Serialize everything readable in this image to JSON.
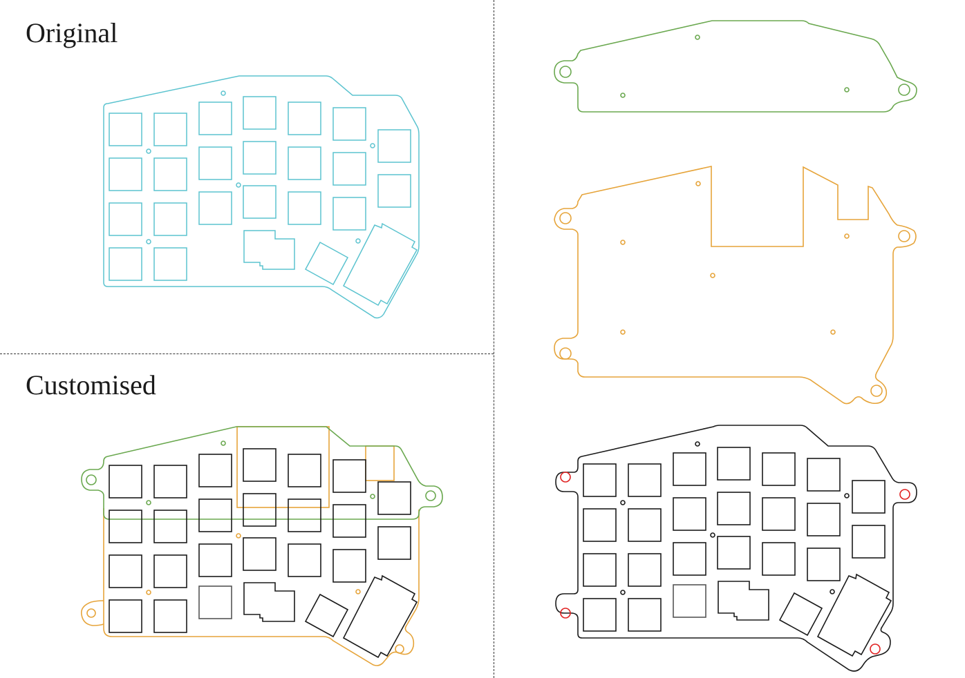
{
  "labels": {
    "original": "Original",
    "customised": "Customised"
  },
  "colors": {
    "original_outline": "#5bc3cf",
    "top_cover": "#6aa84f",
    "bottom_plate": "#e6a43a",
    "switch_plate": "#1a1a1a",
    "mount_hole_highlight": "#e02020",
    "divider": "#333333"
  }
}
